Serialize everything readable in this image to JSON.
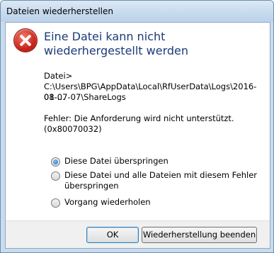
{
  "window": {
    "title": "Dateien wiederherstellen"
  },
  "dialog": {
    "icon": "error-icon",
    "main_instruction": "Eine Datei kann nicht wiederhergestellt werden",
    "file_label": "Datei>",
    "file_path_line1": "C:\\Users\\BPG\\AppData\\Local\\RfUserData\\Logs\\2016-01-...",
    "file_path_line2": "08-07-07\\ShareLogs",
    "error_line1": "Fehler: Die Anforderung wird nicht unterstützt.",
    "error_line2": "(0x80070032)",
    "options": [
      {
        "label_line1": "Diese Datei überspringen",
        "label_line2": "",
        "checked": true
      },
      {
        "label_line1": "Diese Datei und alle Dateien mit diesem Fehler",
        "label_line2": "überspringen",
        "checked": false
      },
      {
        "label_line1": "Vorgang wiederholen",
        "label_line2": "",
        "checked": false
      }
    ]
  },
  "buttons": {
    "ok": "OK",
    "end": "Wiederherstellung beenden"
  }
}
